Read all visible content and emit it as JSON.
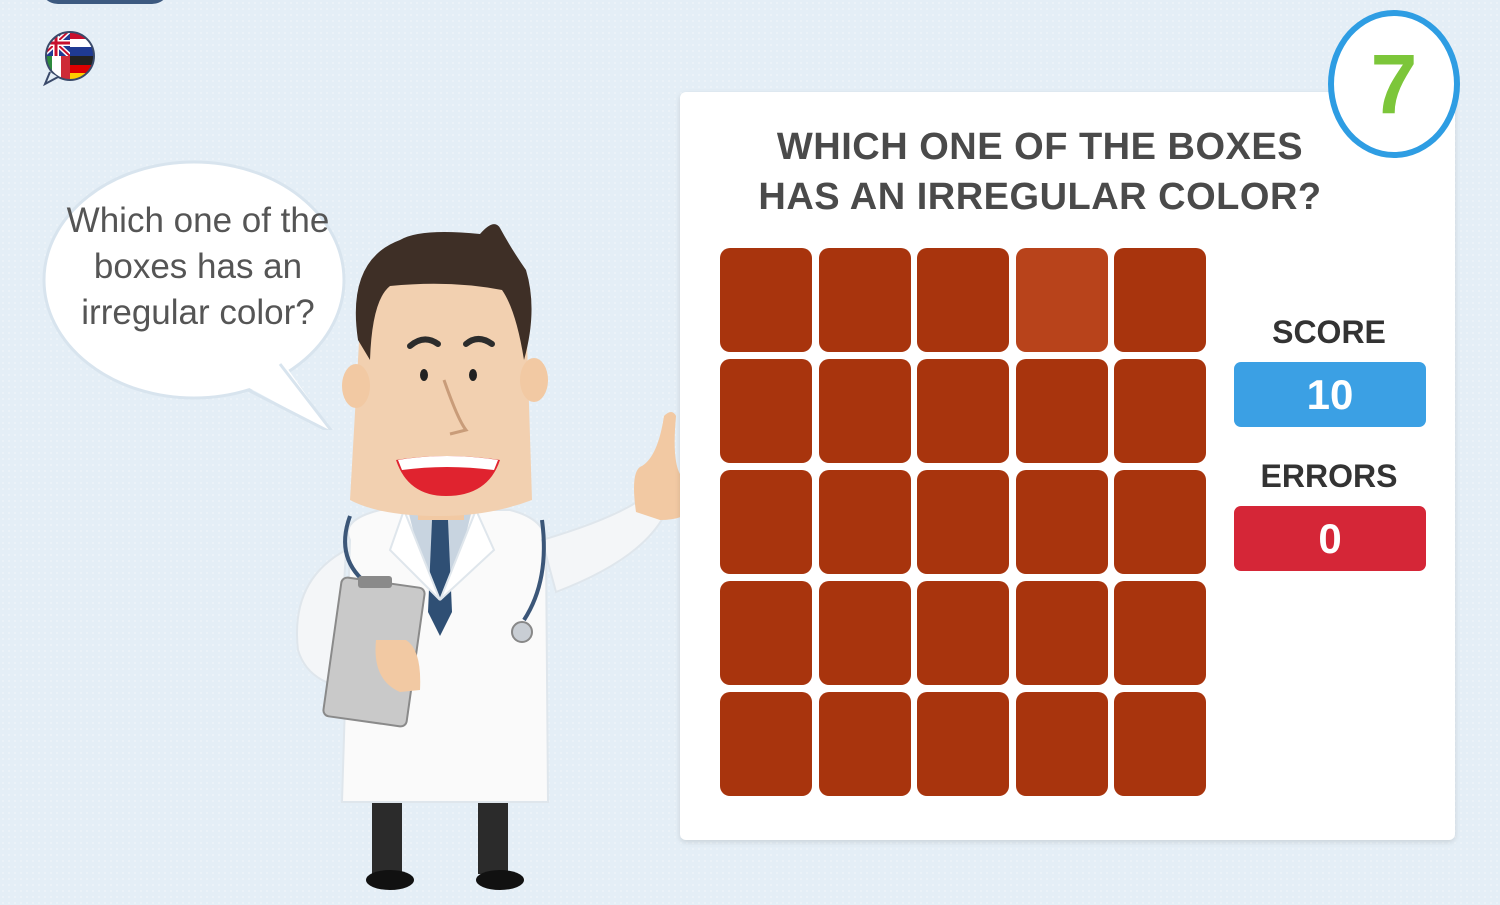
{
  "game": {
    "question_line1": "WHICH ONE OF THE BOXES",
    "question_line2": "HAS AN IRREGULAR COLOR?",
    "speech": "Which one of the boxes has an irregular color?",
    "timer": "7",
    "score_label": "SCORE",
    "score_value": "10",
    "errors_label": "ERRORS",
    "errors_value": "0",
    "language_icon": "flags-speech-bubble-icon"
  },
  "grid": {
    "rows": 5,
    "cols": 5,
    "base_color": "#a8340d",
    "odd_color": "#b8431b",
    "odd_index": 3
  },
  "colors": {
    "timer_ring": "#2e9de3",
    "timer_text": "#7cc63a",
    "score_bg": "#3ba0e4",
    "errors_bg": "#d52637"
  }
}
